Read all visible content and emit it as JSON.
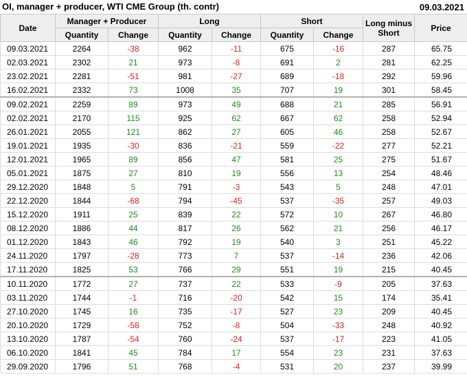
{
  "header": {
    "title": "OI, manager + producer, WTI CME Group (th. contr)",
    "date": "09.03.2021"
  },
  "columns": {
    "date": "Date",
    "group_mp": "Manager + Producer",
    "group_long": "Long",
    "group_short": "Short",
    "long_minus_short_line1": "Long minus",
    "long_minus_short_line2": "Short",
    "price": "Price",
    "quantity": "Quantity",
    "change": "Change"
  },
  "colors": {
    "positive": "#1e8c1e",
    "negative": "#e02020",
    "header_bg": "#eeeeee"
  },
  "rows": [
    {
      "date": "09.03.2021",
      "mp_qty": "2264",
      "mp_chg": "-38",
      "long_qty": "962",
      "long_chg": "-11",
      "short_qty": "675",
      "short_chg": "-16",
      "lms": "287",
      "price": "65.75"
    },
    {
      "date": "02.03.2021",
      "mp_qty": "2302",
      "mp_chg": "21",
      "long_qty": "973",
      "long_chg": "-8",
      "short_qty": "691",
      "short_chg": "2",
      "lms": "281",
      "price": "62.25"
    },
    {
      "date": "23.02.2021",
      "mp_qty": "2281",
      "mp_chg": "-51",
      "long_qty": "981",
      "long_chg": "-27",
      "short_qty": "689",
      "short_chg": "-18",
      "lms": "292",
      "price": "59.96"
    },
    {
      "date": "16.02.2021",
      "mp_qty": "2332",
      "mp_chg": "73",
      "long_qty": "1008",
      "long_chg": "35",
      "short_qty": "707",
      "short_chg": "19",
      "lms": "301",
      "price": "58.45"
    },
    {
      "date": "09.02.2021",
      "mp_qty": "2259",
      "mp_chg": "89",
      "long_qty": "973",
      "long_chg": "49",
      "short_qty": "688",
      "short_chg": "21",
      "lms": "285",
      "price": "56.91"
    },
    {
      "date": "02.02.2021",
      "mp_qty": "2170",
      "mp_chg": "115",
      "long_qty": "925",
      "long_chg": "62",
      "short_qty": "667",
      "short_chg": "62",
      "lms": "258",
      "price": "52.94"
    },
    {
      "date": "26.01.2021",
      "mp_qty": "2055",
      "mp_chg": "121",
      "long_qty": "862",
      "long_chg": "27",
      "short_qty": "605",
      "short_chg": "46",
      "lms": "258",
      "price": "52.67"
    },
    {
      "date": "19.01.2021",
      "mp_qty": "1935",
      "mp_chg": "-30",
      "long_qty": "836",
      "long_chg": "-21",
      "short_qty": "559",
      "short_chg": "-22",
      "lms": "277",
      "price": "52.21"
    },
    {
      "date": "12.01.2021",
      "mp_qty": "1965",
      "mp_chg": "89",
      "long_qty": "856",
      "long_chg": "47",
      "short_qty": "581",
      "short_chg": "25",
      "lms": "275",
      "price": "51.67"
    },
    {
      "date": "05.01.2021",
      "mp_qty": "1875",
      "mp_chg": "27",
      "long_qty": "810",
      "long_chg": "19",
      "short_qty": "556",
      "short_chg": "13",
      "lms": "254",
      "price": "48.46"
    },
    {
      "date": "29.12.2020",
      "mp_qty": "1848",
      "mp_chg": "5",
      "long_qty": "791",
      "long_chg": "-3",
      "short_qty": "543",
      "short_chg": "5",
      "lms": "248",
      "price": "47.01"
    },
    {
      "date": "22.12.2020",
      "mp_qty": "1844",
      "mp_chg": "-68",
      "long_qty": "794",
      "long_chg": "-45",
      "short_qty": "537",
      "short_chg": "-35",
      "lms": "257",
      "price": "49.03"
    },
    {
      "date": "15.12.2020",
      "mp_qty": "1911",
      "mp_chg": "25",
      "long_qty": "839",
      "long_chg": "22",
      "short_qty": "572",
      "short_chg": "10",
      "lms": "267",
      "price": "46.80"
    },
    {
      "date": "08.12.2020",
      "mp_qty": "1886",
      "mp_chg": "44",
      "long_qty": "817",
      "long_chg": "26",
      "short_qty": "562",
      "short_chg": "21",
      "lms": "256",
      "price": "46.17"
    },
    {
      "date": "01.12.2020",
      "mp_qty": "1843",
      "mp_chg": "46",
      "long_qty": "792",
      "long_chg": "19",
      "short_qty": "540",
      "short_chg": "3",
      "lms": "251",
      "price": "45.22"
    },
    {
      "date": "24.11.2020",
      "mp_qty": "1797",
      "mp_chg": "-28",
      "long_qty": "773",
      "long_chg": "7",
      "short_qty": "537",
      "short_chg": "-14",
      "lms": "236",
      "price": "42.06"
    },
    {
      "date": "17.11.2020",
      "mp_qty": "1825",
      "mp_chg": "53",
      "long_qty": "766",
      "long_chg": "29",
      "short_qty": "551",
      "short_chg": "19",
      "lms": "215",
      "price": "40.45"
    },
    {
      "date": "10.11.2020",
      "mp_qty": "1772",
      "mp_chg": "27",
      "long_qty": "737",
      "long_chg": "22",
      "short_qty": "533",
      "short_chg": "-9",
      "lms": "205",
      "price": "37.63"
    },
    {
      "date": "03.11.2020",
      "mp_qty": "1744",
      "mp_chg": "-1",
      "long_qty": "716",
      "long_chg": "-20",
      "short_qty": "542",
      "short_chg": "15",
      "lms": "174",
      "price": "35.41"
    },
    {
      "date": "27.10.2020",
      "mp_qty": "1745",
      "mp_chg": "16",
      "long_qty": "735",
      "long_chg": "-17",
      "short_qty": "527",
      "short_chg": "23",
      "lms": "209",
      "price": "40.45"
    },
    {
      "date": "20.10.2020",
      "mp_qty": "1729",
      "mp_chg": "-58",
      "long_qty": "752",
      "long_chg": "-8",
      "short_qty": "504",
      "short_chg": "-33",
      "lms": "248",
      "price": "40.92"
    },
    {
      "date": "13.10.2020",
      "mp_qty": "1787",
      "mp_chg": "-54",
      "long_qty": "760",
      "long_chg": "-24",
      "short_qty": "537",
      "short_chg": "-17",
      "lms": "223",
      "price": "41.05"
    },
    {
      "date": "06.10.2020",
      "mp_qty": "1841",
      "mp_chg": "45",
      "long_qty": "784",
      "long_chg": "17",
      "short_qty": "554",
      "short_chg": "23",
      "lms": "231",
      "price": "37.63"
    },
    {
      "date": "29.09.2020",
      "mp_qty": "1796",
      "mp_chg": "51",
      "long_qty": "768",
      "long_chg": "-4",
      "short_qty": "531",
      "short_chg": "20",
      "lms": "237",
      "price": "39.99"
    }
  ]
}
